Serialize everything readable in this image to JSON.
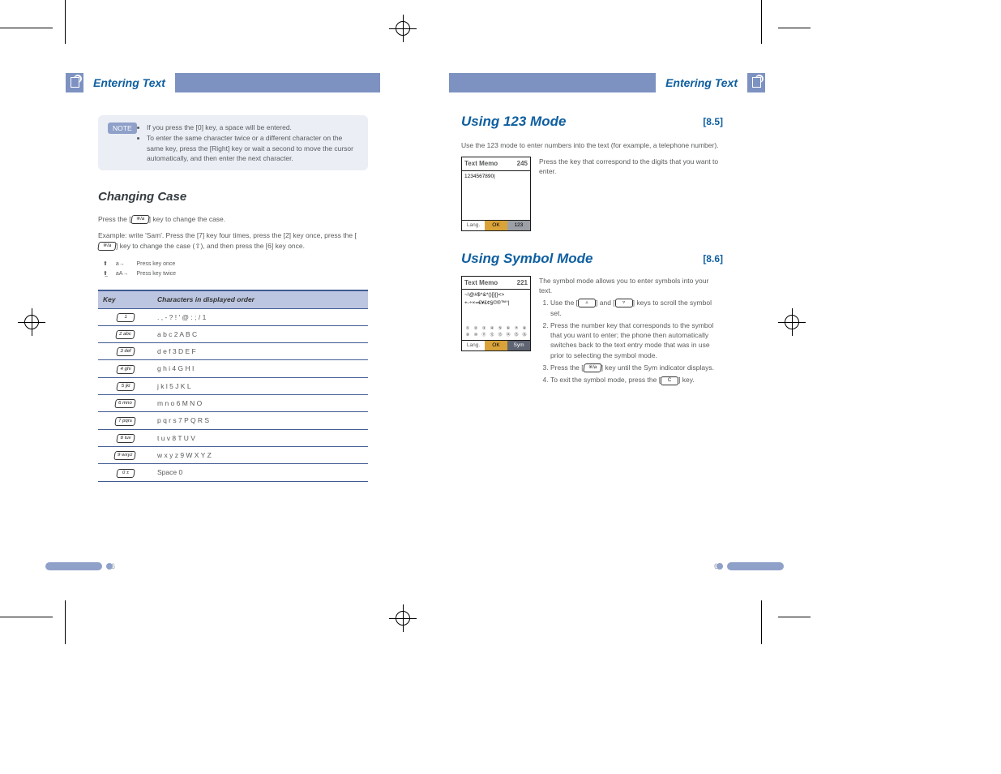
{
  "header": {
    "left_title": "Entering Text",
    "right_title": "Entering Text"
  },
  "left_page": {
    "number": "66",
    "note": {
      "tag": "NOTE",
      "items": [
        "If you press the [0] key, a space will be entered.",
        "To enter the same character twice or a different character on the same key, press the [Right] key or wait a second to move the cursor automatically, and then enter the next character."
      ]
    },
    "subhead": "Changing Case",
    "case_body": {
      "p1": "Press the [     ] key to change the case.",
      "p2": "Example: write 'Sam'. Press the [7] key four times, press the [2] key once, press the [     ] key to change the case (     ), and then press the [6] key once."
    },
    "case_rows": [
      {
        "label": "a→",
        "value": "Press key once"
      },
      {
        "label": "aA→",
        "value": "Press key twice"
      }
    ],
    "char_table": {
      "headers": [
        "Key",
        "Characters in displayed order"
      ],
      "rows": [
        {
          "key": "1",
          "chars": ". , - ? ! ' @ : ; / 1"
        },
        {
          "key": "2 abc",
          "chars": "a b c 2 A B C"
        },
        {
          "key": "3 def",
          "chars": "d e f 3 D E F"
        },
        {
          "key": "4 ghi",
          "chars": "g h i 4 G H I"
        },
        {
          "key": "5 jkl",
          "chars": "j k l 5 J K L"
        },
        {
          "key": "6 mno",
          "chars": "m n o 6 M N O"
        },
        {
          "key": "7 pqrs",
          "chars": "p q r s 7 P Q R S"
        },
        {
          "key": "8 tuv",
          "chars": "t u v 8 T U V"
        },
        {
          "key": "9 wxyz",
          "chars": "w x y z 9 W X Y Z"
        },
        {
          "key": "0 ±",
          "chars": "Space 0"
        }
      ]
    }
  },
  "right_page": {
    "number": "67",
    "section1": {
      "title": "Using 123 Mode",
      "ref": "[8.5]",
      "body": "Use the 123 mode to enter numbers into the text (for example, a telephone number).",
      "body2": "Press the key that correspond to the digits that you want to enter.",
      "screen": {
        "title": "Text Memo",
        "count": "245",
        "content": "1234567890|",
        "soft": {
          "left": "Lang.",
          "mid": "OK",
          "right": "123"
        }
      }
    },
    "section2": {
      "title": "Using Symbol Mode",
      "ref": "[8.6]",
      "body": "The symbol mode allows you to enter symbols into your text.",
      "steps": [
        "Use the [     ] and [     ] keys to scroll the symbol set.",
        "Press the number key that corresponds to the symbol that you want to enter; the phone then automatically switches back to the text entry mode that was in use prior to selecting the symbol mode.",
        "Press the [     ] key until the Sym indicator displays.",
        "To exit the symbol mode, press the [     ] key."
      ],
      "screen": {
        "title": "Text Memo",
        "count": "221",
        "content_lines": [
          "~!@#$^&*()[]{}<>",
          "+-÷×=€¥£¢§©®™°|"
        ],
        "grid": [
          "①",
          "②",
          "③",
          "④",
          "⑤",
          "⑥",
          "⑦",
          "⑧",
          "⑨",
          "⑩",
          "⑪",
          "⑫",
          "⑬",
          "⑭",
          "⑮",
          "⑯"
        ],
        "soft": {
          "left": "Lang.",
          "mid": "OK",
          "right": "Sym"
        }
      }
    }
  }
}
